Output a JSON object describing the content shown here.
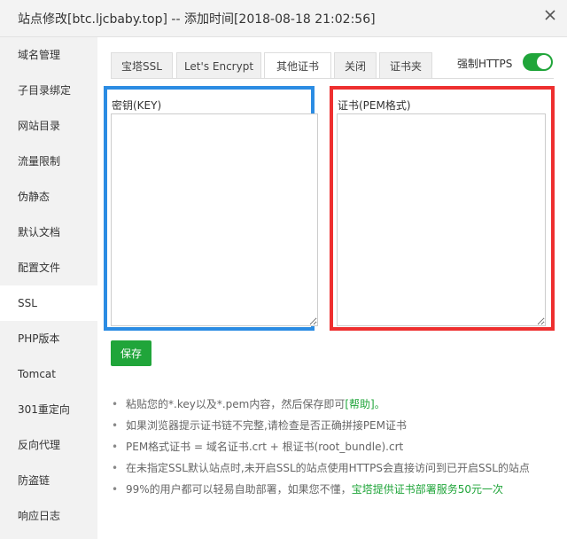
{
  "window": {
    "title": "站点修改[btc.ljcbaby.top] -- 添加时间[2018-08-18 21:02:56]",
    "close_icon": "close-icon"
  },
  "sidebar": {
    "items": [
      {
        "label": "域名管理"
      },
      {
        "label": "子目录绑定"
      },
      {
        "label": "网站目录"
      },
      {
        "label": "流量限制"
      },
      {
        "label": "伪静态"
      },
      {
        "label": "默认文档"
      },
      {
        "label": "配置文件"
      },
      {
        "label": "SSL"
      },
      {
        "label": "PHP版本"
      },
      {
        "label": "Tomcat"
      },
      {
        "label": "301重定向"
      },
      {
        "label": "反向代理"
      },
      {
        "label": "防盗链"
      },
      {
        "label": "响应日志"
      }
    ],
    "active": "SSL"
  },
  "tabs": [
    {
      "label": "宝塔SSL"
    },
    {
      "label": "Let's Encrypt"
    },
    {
      "label": "其他证书"
    },
    {
      "label": "关闭"
    },
    {
      "label": "证书夹"
    }
  ],
  "active_tab": "其他证书",
  "https": {
    "label": "强制HTTPS",
    "enabled": true
  },
  "key_panel": {
    "label": "密钥(KEY)",
    "value": ""
  },
  "pem_panel": {
    "label": "证书(PEM格式)",
    "value": ""
  },
  "save_label": "保存",
  "notes": [
    {
      "text": "粘贴您的*.key以及*.pem内容，然后保存即可",
      "link": "[帮助]。"
    },
    {
      "text": "如果浏览器提示证书链不完整,请检查是否正确拼接PEM证书"
    },
    {
      "text": "PEM格式证书 = 域名证书.crt + 根证书(root_bundle).crt"
    },
    {
      "text": "在未指定SSL默认站点时,未开启SSL的站点使用HTTPS会直接访问到已开启SSL的站点"
    },
    {
      "text": "99%的用户都可以轻易自助部署，如果您不懂，",
      "link": "宝塔提供证书部署服务50元一次"
    }
  ],
  "colors": {
    "accent_green": "#20a53a",
    "highlight_blue": "#2b8ce3",
    "highlight_red": "#ee2f2f"
  }
}
